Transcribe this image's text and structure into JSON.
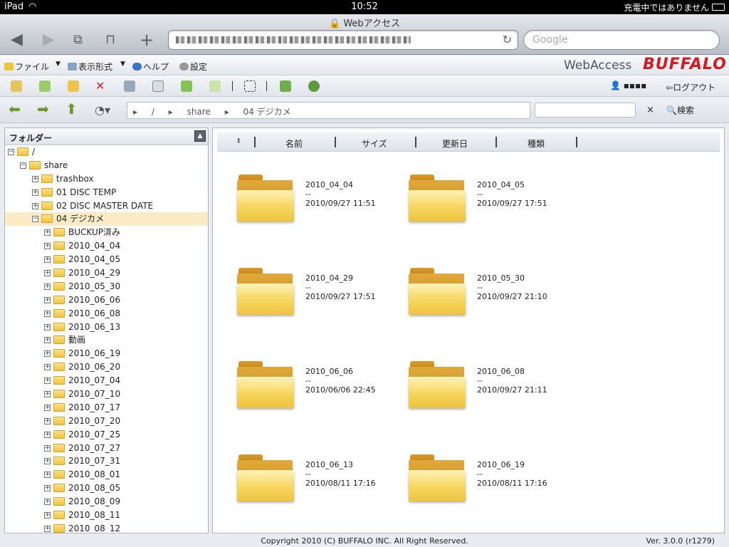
{
  "status": {
    "device": "iPad",
    "time": "10:52",
    "charge": "充電中ではありません"
  },
  "browser": {
    "title": "Webアクセス",
    "search_placeholder": "Google"
  },
  "menu": {
    "file": "ファイル",
    "view": "表示形式",
    "help": "ヘルプ",
    "settings": "設定"
  },
  "brand": {
    "app": "WebAccess",
    "logo": "BUFFALO"
  },
  "toolbar": {
    "user": "▪▪▪▪",
    "logout": "ログアウト"
  },
  "nav": {
    "breadcrumb": [
      "/",
      "share",
      "04 デジカメ"
    ],
    "clear": "×",
    "search_button": "検索"
  },
  "folder_panel": {
    "title": "フォルダー",
    "tree": [
      {
        "label": "/",
        "level": 0,
        "expanded": true
      },
      {
        "label": "share",
        "level": 1,
        "expanded": true
      },
      {
        "label": "trashbox",
        "level": 2,
        "expanded": false
      },
      {
        "label": "01 DISC TEMP",
        "level": 2,
        "expanded": false
      },
      {
        "label": "02 DISC MASTER DATE",
        "level": 2,
        "expanded": false
      },
      {
        "label": "04 デジカメ",
        "level": 2,
        "expanded": true,
        "selected": true
      },
      {
        "label": "BUCKUP済み",
        "level": 3,
        "expanded": false
      },
      {
        "label": "2010_04_04",
        "level": 3,
        "expanded": false
      },
      {
        "label": "2010_04_05",
        "level": 3,
        "expanded": false
      },
      {
        "label": "2010_04_29",
        "level": 3,
        "expanded": false
      },
      {
        "label": "2010_05_30",
        "level": 3,
        "expanded": false
      },
      {
        "label": "2010_06_06",
        "level": 3,
        "expanded": false
      },
      {
        "label": "2010_06_08",
        "level": 3,
        "expanded": false
      },
      {
        "label": "2010_06_13",
        "level": 3,
        "expanded": false
      },
      {
        "label": "動画",
        "level": 3,
        "expanded": false
      },
      {
        "label": "2010_06_19",
        "level": 3,
        "expanded": false
      },
      {
        "label": "2010_06_20",
        "level": 3,
        "expanded": false
      },
      {
        "label": "2010_07_04",
        "level": 3,
        "expanded": false
      },
      {
        "label": "2010_07_10",
        "level": 3,
        "expanded": false
      },
      {
        "label": "2010_07_17",
        "level": 3,
        "expanded": false
      },
      {
        "label": "2010_07_20",
        "level": 3,
        "expanded": false
      },
      {
        "label": "2010_07_25",
        "level": 3,
        "expanded": false
      },
      {
        "label": "2010_07_27",
        "level": 3,
        "expanded": false
      },
      {
        "label": "2010_07_31",
        "level": 3,
        "expanded": false
      },
      {
        "label": "2010_08_01",
        "level": 3,
        "expanded": false
      },
      {
        "label": "2010_08_05",
        "level": 3,
        "expanded": false
      },
      {
        "label": "2010_08_09",
        "level": 3,
        "expanded": false
      },
      {
        "label": "2010_08_11",
        "level": 3,
        "expanded": false
      },
      {
        "label": "2010_08_12",
        "level": 3,
        "expanded": false
      }
    ]
  },
  "file_panel": {
    "columns": [
      "名前",
      "サイズ",
      "更新日",
      "種類"
    ],
    "items": [
      {
        "name": "2010_04_04",
        "size": "--",
        "date": "2010/09/27 11:51"
      },
      {
        "name": "2010_04_05",
        "size": "--",
        "date": "2010/09/27 17:51"
      },
      {
        "name": "2010_04_29",
        "size": "--",
        "date": "2010/09/27 17:51"
      },
      {
        "name": "2010_05_30",
        "size": "--",
        "date": "2010/09/27 21:10"
      },
      {
        "name": "2010_06_06",
        "size": "--",
        "date": "2010/06/06 22:45"
      },
      {
        "name": "2010_06_08",
        "size": "--",
        "date": "2010/09/27 21:11"
      },
      {
        "name": "2010_06_13",
        "size": "--",
        "date": "2010/08/11 17:16"
      },
      {
        "name": "2010_06_19",
        "size": "--",
        "date": "2010/08/11 17:16"
      }
    ]
  },
  "footer": {
    "copyright": "Copyright 2010 (C) BUFFALO INC. All Right Reserved.",
    "version": "Ver. 3.0.0 (r1279)"
  },
  "colors": {
    "brand_red": "#d71920",
    "selected_row": "#fdebc5",
    "nav_green": "#6d9a2c"
  }
}
